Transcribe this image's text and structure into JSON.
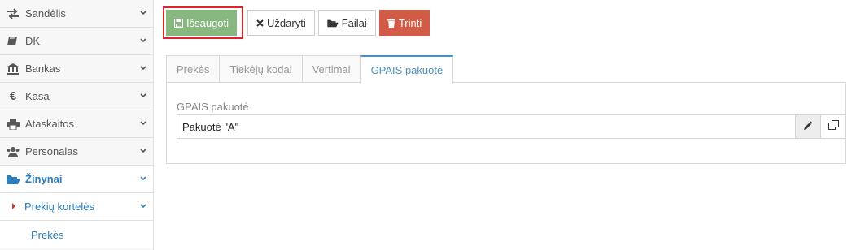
{
  "sidebar": {
    "items": [
      {
        "label": "Sandėlis",
        "icon": "exchange-icon"
      },
      {
        "label": "DK",
        "icon": "book-icon"
      },
      {
        "label": "Bankas",
        "icon": "bank-icon"
      },
      {
        "label": "Kasa",
        "icon": "euro-icon"
      },
      {
        "label": "Ataskaitos",
        "icon": "print-icon"
      },
      {
        "label": "Personalas",
        "icon": "users-icon"
      },
      {
        "label": "Žinynai",
        "icon": "folder-open-icon"
      },
      {
        "label": "Prekių kortelės"
      },
      {
        "label": "Prekės"
      }
    ]
  },
  "toolbar": {
    "save_label": "Išsaugoti",
    "close_label": "Uždaryti",
    "files_label": "Failai",
    "delete_label": "Trinti"
  },
  "tabs": [
    {
      "label": "Prekės"
    },
    {
      "label": "Tiekėjų kodai"
    },
    {
      "label": "Vertimai"
    },
    {
      "label": "GPAIS pakuotė"
    }
  ],
  "form": {
    "field_label": "GPAIS pakuotė",
    "field_value": "Pakuotė \"A\""
  },
  "colors": {
    "accent": "#2b7dbc",
    "save": "#87b87f",
    "delete": "#d15b47",
    "highlight": "#e0222b"
  }
}
